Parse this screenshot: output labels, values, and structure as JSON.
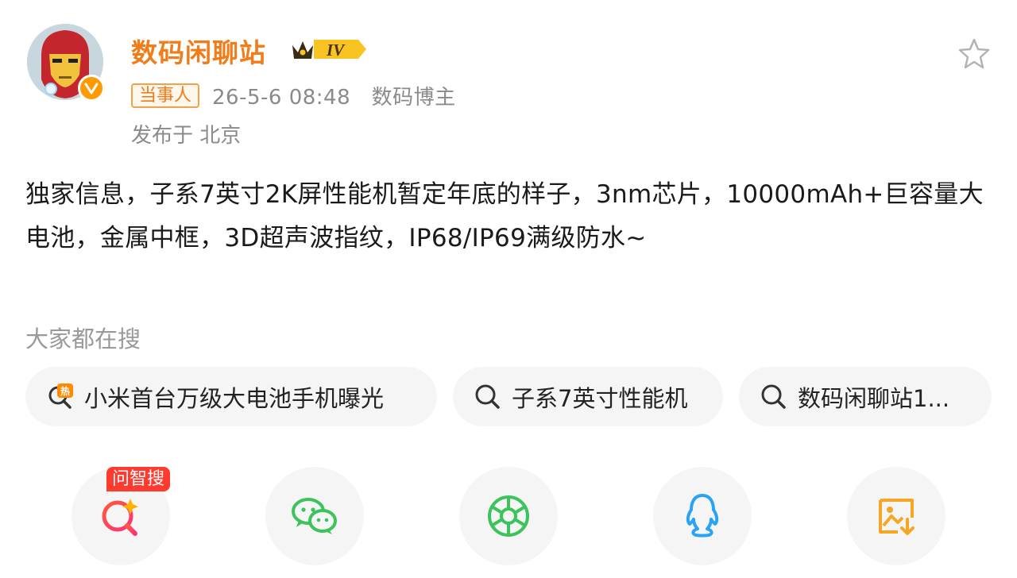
{
  "user": {
    "name": "数码闲聊站",
    "level": "IV",
    "tag": "当事人",
    "meta": "26-5-6 08:48　数码博主",
    "location": "发布于 北京"
  },
  "post": {
    "text": "独家信息，子系7英寸2K屏性能机暂定年底的样子，3nm芯片，10000mAh+巨容量大电池，金属中框，3D超声波指纹，IP68/IP69满级防水~"
  },
  "search": {
    "title": "大家都在搜",
    "chips": [
      {
        "label": "小米首台万级大电池手机曝光",
        "icon": "hot-search-icon"
      },
      {
        "label": "子系7英寸性能机",
        "icon": "search-icon"
      },
      {
        "label": "数码闲聊站1...",
        "icon": "search-icon"
      }
    ]
  },
  "share": {
    "ai_badge": "问智搜",
    "buttons": [
      {
        "icon": "ai-search-icon"
      },
      {
        "icon": "wechat-icon"
      },
      {
        "icon": "moments-icon"
      },
      {
        "icon": "qq-icon"
      },
      {
        "icon": "save-image-icon"
      }
    ]
  },
  "colors": {
    "brand_orange": "#f07c1a",
    "meta_gray": "#8a8a8a",
    "hot_red": "#ff3a2f",
    "wechat_green": "#3cc35c",
    "qq_blue": "#2aa3f5",
    "save_orange": "#f6a623"
  }
}
